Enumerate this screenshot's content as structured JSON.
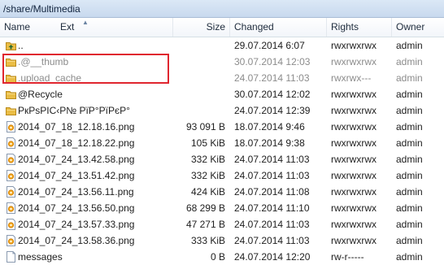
{
  "window": {
    "path": "/share/Multimedia"
  },
  "columns": {
    "name": "Name",
    "ext": "Ext",
    "size": "Size",
    "changed": "Changed",
    "rights": "Rights",
    "owner": "Owner"
  },
  "colors": {
    "highlight": "#e0262f",
    "folder": "#e8b93a",
    "hidden_text": "#8c8c8c"
  },
  "files": [
    {
      "icon": "parent-dir-icon",
      "name": "..",
      "size": "",
      "changed": "29.07.2014 6:07",
      "rights": "rwxrwxrwx",
      "owner": "admin",
      "hidden": false
    },
    {
      "icon": "folder-icon",
      "name": ".@__thumb",
      "size": "",
      "changed": "30.07.2014 12:03",
      "rights": "rwxrwxrwx",
      "owner": "admin",
      "hidden": true
    },
    {
      "icon": "folder-icon",
      "name": ".upload_cache",
      "size": "",
      "changed": "24.07.2014 11:03",
      "rights": "rwxrwx---",
      "owner": "admin",
      "hidden": true
    },
    {
      "icon": "folder-icon",
      "name": "@Recycle",
      "size": "",
      "changed": "30.07.2014 12:02",
      "rights": "rwxrwxrwx",
      "owner": "admin",
      "hidden": false
    },
    {
      "icon": "folder-icon",
      "name": "РкРѕРІС‹Р№ РїР°РїРєР°",
      "size": "",
      "changed": "24.07.2014 12:39",
      "rights": "rwxrwxrwx",
      "owner": "admin",
      "hidden": false
    },
    {
      "icon": "image-file-icon",
      "name": "2014_07_18_12.18.16.png",
      "size": "93 091 B",
      "changed": "18.07.2014 9:46",
      "rights": "rwxrwxrwx",
      "owner": "admin",
      "hidden": false
    },
    {
      "icon": "image-file-icon",
      "name": "2014_07_18_12.18.22.png",
      "size": "105 KiB",
      "changed": "18.07.2014 9:38",
      "rights": "rwxrwxrwx",
      "owner": "admin",
      "hidden": false
    },
    {
      "icon": "image-file-icon",
      "name": "2014_07_24_13.42.58.png",
      "size": "332 KiB",
      "changed": "24.07.2014 11:03",
      "rights": "rwxrwxrwx",
      "owner": "admin",
      "hidden": false
    },
    {
      "icon": "image-file-icon",
      "name": "2014_07_24_13.51.42.png",
      "size": "332 KiB",
      "changed": "24.07.2014 11:03",
      "rights": "rwxrwxrwx",
      "owner": "admin",
      "hidden": false
    },
    {
      "icon": "image-file-icon",
      "name": "2014_07_24_13.56.11.png",
      "size": "424 KiB",
      "changed": "24.07.2014 11:08",
      "rights": "rwxrwxrwx",
      "owner": "admin",
      "hidden": false
    },
    {
      "icon": "image-file-icon",
      "name": "2014_07_24_13.56.50.png",
      "size": "68 299 B",
      "changed": "24.07.2014 11:10",
      "rights": "rwxrwxrwx",
      "owner": "admin",
      "hidden": false
    },
    {
      "icon": "image-file-icon",
      "name": "2014_07_24_13.57.33.png",
      "size": "47 271 B",
      "changed": "24.07.2014 11:03",
      "rights": "rwxrwxrwx",
      "owner": "admin",
      "hidden": false
    },
    {
      "icon": "image-file-icon",
      "name": "2014_07_24_13.58.36.png",
      "size": "333 KiB",
      "changed": "24.07.2014 11:03",
      "rights": "rwxrwxrwx",
      "owner": "admin",
      "hidden": false
    },
    {
      "icon": "text-file-icon",
      "name": "messages",
      "size": "0 B",
      "changed": "24.07.2014 12:20",
      "rights": "rw-r-----",
      "owner": "admin",
      "hidden": false
    }
  ]
}
